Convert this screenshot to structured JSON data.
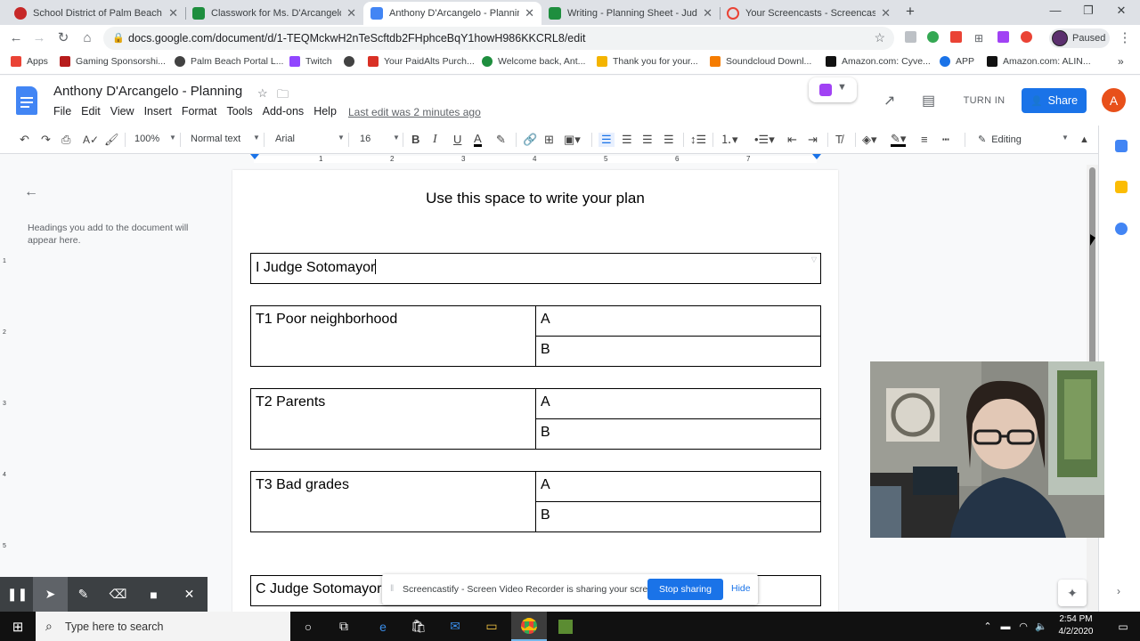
{
  "browser": {
    "tabs": [
      {
        "title": "School District of Palm Beach Co",
        "favicon_color": "#c62828"
      },
      {
        "title": "Classwork for Ms. D'Arcangelo - ",
        "favicon_color": "#1e8e3e"
      },
      {
        "title": "Anthony D'Arcangelo - Planning",
        "favicon_color": "#4285f4"
      },
      {
        "title": "Writing - Planning Sheet - Judge",
        "favicon_color": "#1e8e3e"
      },
      {
        "title": "Your Screencasts - Screencastify",
        "favicon_color": "#ea4335"
      }
    ],
    "url": "docs.google.com/document/d/1-TEQMckwH2nTeScftdb2FHphceBqY1howH986KKCRL8/edit",
    "profile_label": "Paused",
    "bookmarks": [
      {
        "label": "Apps",
        "color": "#ea4335"
      },
      {
        "label": "Gaming Sponsorshi...",
        "color": "#b71c1c"
      },
      {
        "label": "Palm Beach Portal L...",
        "color": "#424242"
      },
      {
        "label": "Twitch",
        "color": "#9146ff"
      },
      {
        "label": "",
        "color": "#424242"
      },
      {
        "label": "Your PaidAlts Purch...",
        "color": "#d93025"
      },
      {
        "label": "Welcome back, Ant...",
        "color": "#1e8e3e"
      },
      {
        "label": "Thank you for your...",
        "color": "#f4b400"
      },
      {
        "label": "Soundcloud Downl...",
        "color": "#f57c00"
      },
      {
        "label": "Amazon.com: Cyve...",
        "color": "#111111"
      },
      {
        "label": "APP",
        "color": "#1a73e8"
      },
      {
        "label": "Amazon.com: ALIN...",
        "color": "#111111"
      }
    ]
  },
  "docs": {
    "title": "Anthony D'Arcangelo - Planning",
    "menus": [
      "File",
      "Edit",
      "View",
      "Insert",
      "Format",
      "Tools",
      "Add-ons",
      "Help"
    ],
    "last_edit": "Last edit was 2 minutes ago",
    "turn_in_label": "TURN IN",
    "share_label": "Share",
    "avatar_letter": "A",
    "toolbar": {
      "zoom": "100%",
      "style": "Normal text",
      "font": "Arial",
      "size": "16",
      "mode": "Editing"
    },
    "ruler": [
      "1",
      "2",
      "3",
      "4",
      "5",
      "6",
      "7"
    ],
    "left_ruler": [
      "1",
      "2",
      "3",
      "4",
      "5"
    ],
    "outline_hint": "Headings you add to the document will appear here."
  },
  "page": {
    "heading": "Use this space to write your plan",
    "intro": "I Judge Sotomayor",
    "topics": [
      {
        "label": "T1 Poor neighborhood",
        "a": "A",
        "b": "B"
      },
      {
        "label": "T2 Parents",
        "a": "A",
        "b": "B"
      },
      {
        "label": "T3 Bad grades",
        "a": "A",
        "b": "B"
      }
    ],
    "conclusion": "C Judge Sotomayor"
  },
  "screencastify": {
    "notice": "Screencastify - Screen Video Recorder is sharing your screen.",
    "stop_label": "Stop sharing",
    "hide_label": "Hide"
  },
  "taskbar": {
    "search_placeholder": "Type here to search",
    "time": "2:54 PM",
    "date": "4/2/2020"
  }
}
